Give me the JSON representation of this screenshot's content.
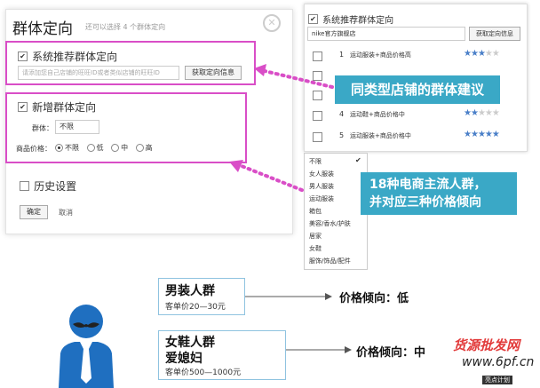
{
  "dialog": {
    "title": "群体定向",
    "subtitle": "还可以选择 4 个群体定向",
    "close_glyph": "✕",
    "system_section": {
      "label": "系统推荐群体定向",
      "checked_glyph": "✔",
      "placeholder": "请添加您自己店铺的旺旺ID或者类似店铺的旺旺ID",
      "button": "获取定向信息"
    },
    "new_section": {
      "label": "新增群体定向",
      "checked_glyph": "✔",
      "group_label": "群体：",
      "group_value": "不限",
      "price_label": "商品价格：",
      "price_options": [
        "不限",
        "低",
        "中",
        "高"
      ],
      "price_selected": 0
    },
    "history": {
      "label": "历史设置"
    },
    "confirm": "确定",
    "cancel": "取消"
  },
  "popup": {
    "header": "系统推荐群体定向",
    "checked_glyph": "✔",
    "shop_value": "nike官方旗舰店",
    "button": "获取定向信息",
    "rows": [
      {
        "num": "1",
        "text": "运动服装+商品价格高",
        "stars": 3
      },
      {
        "num": "4",
        "text": "运动鞋+商品价格中",
        "stars": 2
      },
      {
        "num": "5",
        "text": "运动服装+商品价格中",
        "stars": 5
      }
    ],
    "max_stars": 5
  },
  "callout_top": "同类型店铺的群体建议",
  "callout_right": {
    "line1": "18种电商主流人群，",
    "line2": "并对应三种价格倾向"
  },
  "dropdown": {
    "check_glyph": "✔",
    "items": [
      "不限",
      "女人服装",
      "男人服装",
      "运动服装",
      "箱包",
      "美容/香水/护肤",
      "居家",
      "女鞋",
      "服饰/饰品/配件"
    ]
  },
  "examples": [
    {
      "title": "男装人群",
      "sub": "客单价20—30元",
      "arrow_label": "价格倾向：低"
    },
    {
      "title": "女鞋人群",
      "title2": "爱媳妇",
      "sub": "客单价500—1000元",
      "arrow_label": "价格倾向：中"
    }
  ],
  "watermark": {
    "line1": "货源批发网",
    "line2": "www.6pf.cn",
    "badge": "亮点计划"
  },
  "colors": {
    "accent_pink": "#d94ec7",
    "callout_bg": "#3aa8c6",
    "star_blue": "#4a7fc8",
    "person_blue": "#1f6fc0"
  }
}
